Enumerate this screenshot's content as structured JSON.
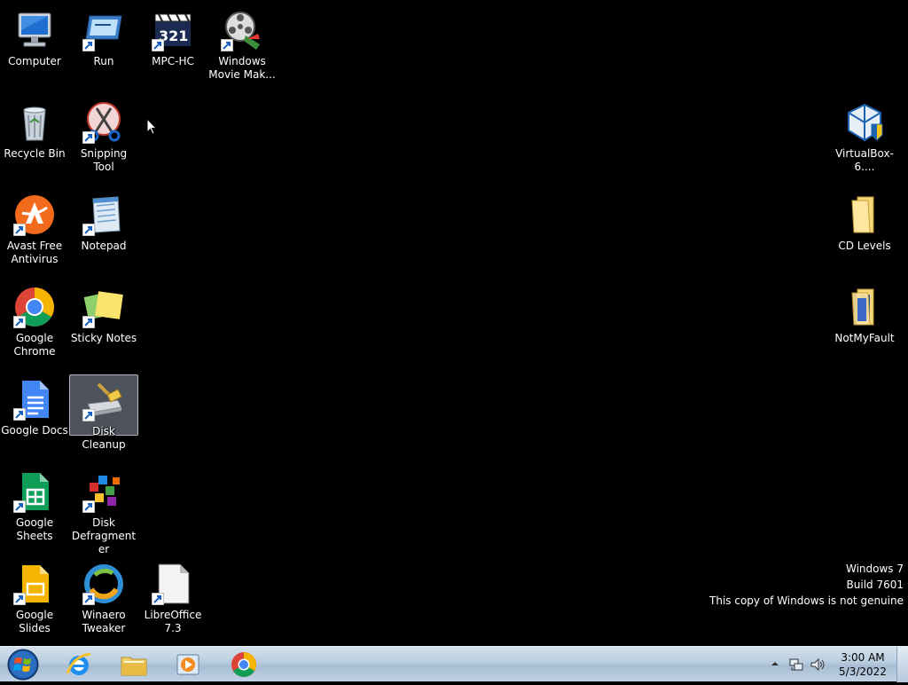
{
  "desktop": {
    "icons": {
      "computer": "Computer",
      "run": "Run",
      "mpchc": "MPC-HC",
      "moviemaker": "Windows Movie Mak...",
      "recycle": "Recycle Bin",
      "snipping": "Snipping Tool",
      "virtualbox": "VirtualBox-6....",
      "avast": "Avast Free Antivirus",
      "notepad": "Notepad",
      "cdlevels": "CD Levels",
      "chrome": "Google Chrome",
      "sticky": "Sticky Notes",
      "notmyfault": "NotMyFault",
      "gdocs": "Google Docs",
      "diskcleanup": "Disk Cleanup",
      "gsheets": "Google Sheets",
      "defrag": "Disk Defragmenter",
      "gslides": "Google Slides",
      "winaero": "Winaero Tweaker",
      "libreoffice": "LibreOffice 7.3"
    },
    "selected_icon": "Disk Cleanup"
  },
  "watermark": {
    "line1": "Windows 7",
    "line2": "Build 7601",
    "line3": "This copy of Windows is not genuine"
  },
  "taskbar": {
    "pinned": [
      "Internet Explorer",
      "Windows Explorer",
      "Windows Media Player",
      "Google Chrome"
    ],
    "clock_time": "3:00 AM",
    "clock_date": "5/3/2022"
  },
  "colors": {
    "desktop_background": "#000000",
    "taskbar_top": "#d3e0ec",
    "taskbar_bottom": "#a7bdd3",
    "selection": "#8c96a5"
  }
}
